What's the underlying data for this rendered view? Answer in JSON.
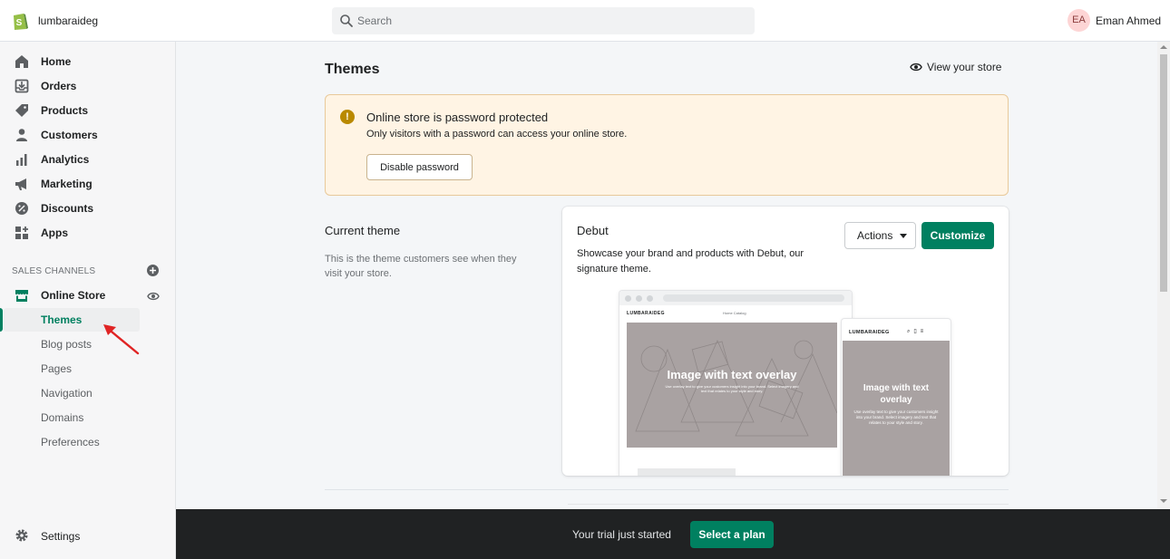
{
  "header": {
    "store_name": "lumbaraideg",
    "search_placeholder": "Search",
    "avatar_initials": "EA",
    "user_name": "Eman Ahmed"
  },
  "sidebar": {
    "items": [
      {
        "label": "Home",
        "icon": "home-icon"
      },
      {
        "label": "Orders",
        "icon": "orders-icon"
      },
      {
        "label": "Products",
        "icon": "tag-icon"
      },
      {
        "label": "Customers",
        "icon": "person-icon"
      },
      {
        "label": "Analytics",
        "icon": "bar-chart-icon"
      },
      {
        "label": "Marketing",
        "icon": "megaphone-icon"
      },
      {
        "label": "Discounts",
        "icon": "discount-icon"
      },
      {
        "label": "Apps",
        "icon": "apps-icon"
      }
    ],
    "channels_title": "SALES CHANNELS",
    "online_store": "Online Store",
    "sub_items": [
      "Themes",
      "Blog posts",
      "Pages",
      "Navigation",
      "Domains",
      "Preferences"
    ],
    "active_sub_item": "Themes",
    "settings": "Settings"
  },
  "main": {
    "title": "Themes",
    "view_store": "View your store",
    "banner": {
      "title": "Online store is password protected",
      "text": "Only visitors with a password can access your online store.",
      "button": "Disable password"
    },
    "current_theme": {
      "title": "Current theme",
      "description": "This is the theme customers see when they visit your store."
    },
    "theme_card": {
      "name": "Debut",
      "description": "Showcase your brand and products with Debut, our signature theme.",
      "actions_label": "Actions",
      "customize_label": "Customize",
      "preview": {
        "desktop_brand": "LUMBARAIDEG",
        "desktop_links": "Home   Catalog",
        "hero_title": "Image with text overlay",
        "hero_sub": "Use overlay text to give your customers insight into your brand. Select imagery and text that relates to your style and story.",
        "mobile_brand": "LUMBARAIDEG",
        "mobile_hero_title": "Image with text overlay",
        "mobile_hero_sub": "Use overlay text to give your customers insight into your brand. Select imagery and text that relates to your style and story."
      }
    }
  },
  "trial": {
    "text": "Your trial just started",
    "button": "Select a plan"
  },
  "colors": {
    "accent": "#008060",
    "banner_bg": "#fff4e4",
    "warning": "#b98900",
    "annotation_arrow": "#e02424"
  }
}
